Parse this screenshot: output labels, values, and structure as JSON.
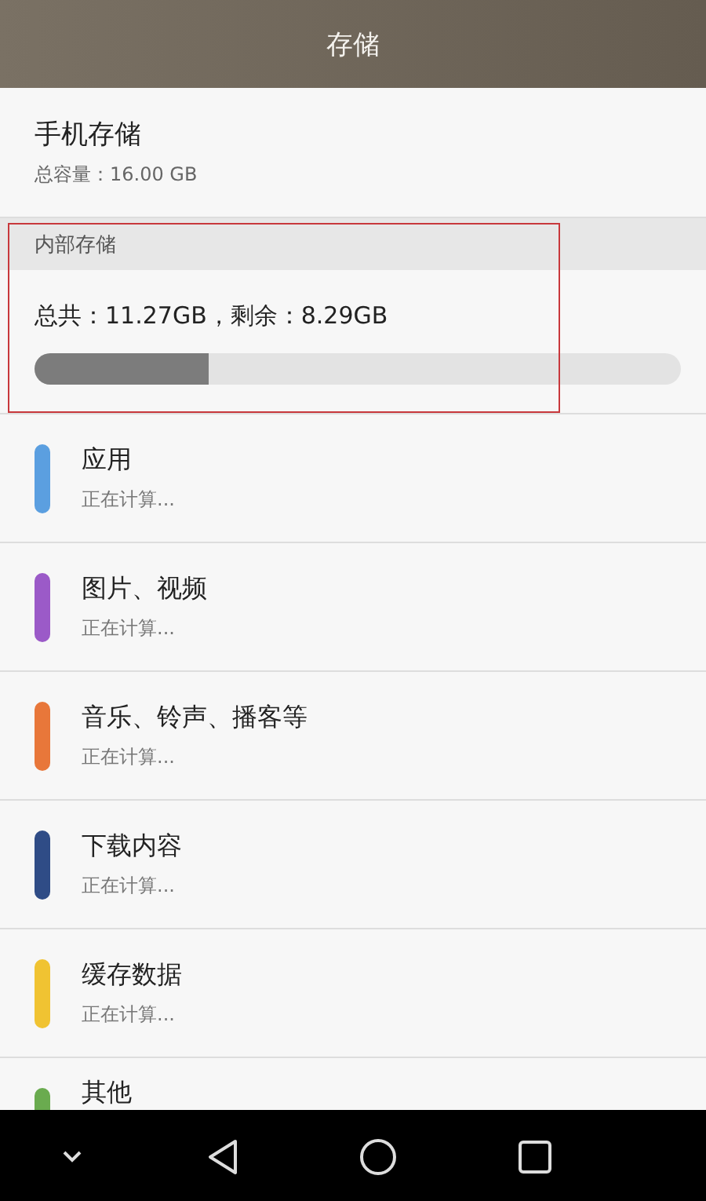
{
  "header": {
    "title": "存储"
  },
  "phone_storage": {
    "title": "手机存储",
    "capacity": "总容量：16.00 GB"
  },
  "internal_storage": {
    "heading": "内部存储",
    "highlighted": true,
    "summary": "总共：11.27GB，剩余：8.29GB",
    "level": 0.27
  },
  "categories": [
    {
      "name": "应用",
      "status": "正在计算...",
      "color": "#5b9fe0"
    },
    {
      "name": "图片、视频",
      "status": "正在计算...",
      "color": "#9b5ac8"
    },
    {
      "name": "音乐、铃声、播客等",
      "status": "正在计算...",
      "color": "#e8773a"
    },
    {
      "name": "下载内容",
      "status": "正在计算...",
      "color": "#2f4c86"
    },
    {
      "name": "缓存数据",
      "status": "正在计算...",
      "color": "#f0c332"
    },
    {
      "name": "其他",
      "color": "#6aab4f"
    }
  ]
}
